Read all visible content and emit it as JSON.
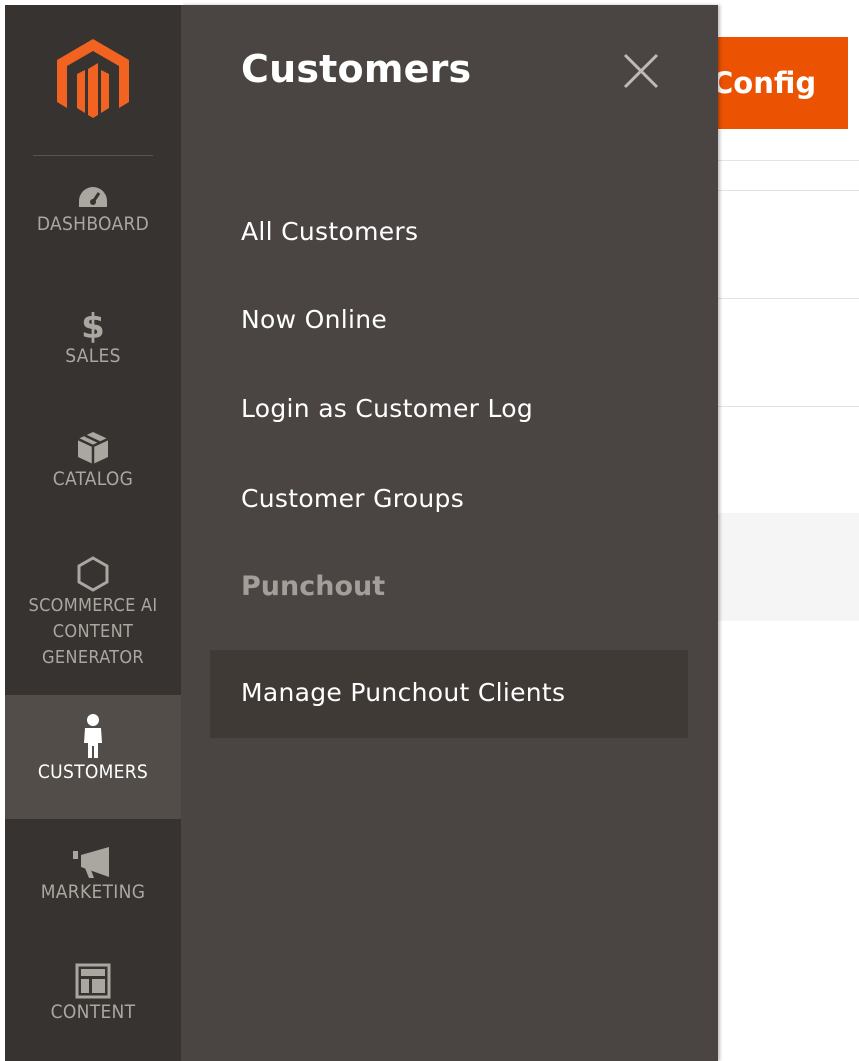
{
  "admin_menu": {
    "logo_icon": "magento-logo-icon",
    "items": [
      {
        "label": "DASHBOARD",
        "icon": "dashboard-gauge-icon"
      },
      {
        "label": "SALES",
        "icon": "dollar-icon"
      },
      {
        "label": "CATALOG",
        "icon": "box-icon"
      },
      {
        "label": "SCOMMERCE AI",
        "label2": "CONTENT",
        "label3": "GENERATOR",
        "icon": "hexagon-icon"
      },
      {
        "label": "CUSTOMERS",
        "icon": "person-icon",
        "active": true
      },
      {
        "label": "MARKETING",
        "icon": "megaphone-icon"
      },
      {
        "label": "CONTENT",
        "icon": "layout-icon"
      }
    ]
  },
  "submenu": {
    "title": "Customers",
    "close_icon": "close-icon",
    "links": [
      "All Customers",
      "Now Online",
      "Login as Customer Log",
      "Customer Groups"
    ],
    "section_title": "Punchout",
    "section_links": [
      "Manage Punchout Clients"
    ]
  },
  "page": {
    "config_button": "Config"
  },
  "colors": {
    "menu_bg": "#373330",
    "menu_active": "#524d49",
    "submenu_bg": "#4a4542",
    "accent": "#eb5202",
    "logo": "#f26322"
  }
}
